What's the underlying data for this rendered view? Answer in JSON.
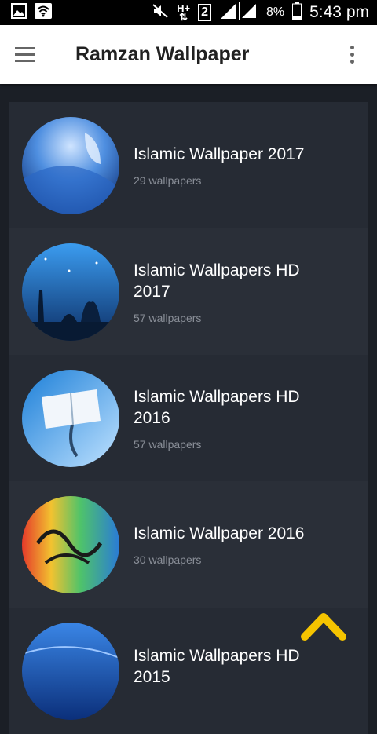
{
  "status_bar": {
    "network_type": "H+",
    "sim_slot": "2",
    "battery_percent": "8%",
    "time": "5:43 pm"
  },
  "app_bar": {
    "title": "Ramzan Wallpaper"
  },
  "categories": [
    {
      "title": "Islamic Wallpaper 2017",
      "count": "29 wallpapers",
      "thumb_colors": [
        "#7fb4f2",
        "#1f5fb8"
      ]
    },
    {
      "title": "Islamic Wallpapers HD 2017",
      "count": "57 wallpapers",
      "thumb_colors": [
        "#2f8fe0",
        "#0c2a5c"
      ]
    },
    {
      "title": "Islamic Wallpapers HD 2016",
      "count": "57 wallpapers",
      "thumb_colors": [
        "#4aa8f0",
        "#c9e6ff"
      ]
    },
    {
      "title": "Islamic Wallpaper 2016",
      "count": "30 wallpapers",
      "thumb_colors": [
        "#f2c230",
        "#2a7bd6"
      ]
    },
    {
      "title": "Islamic Wallpapers HD 2015",
      "count": "",
      "thumb_colors": [
        "#2a6fd1",
        "#0b2f7a"
      ]
    }
  ],
  "accent_color": "#f5c400"
}
